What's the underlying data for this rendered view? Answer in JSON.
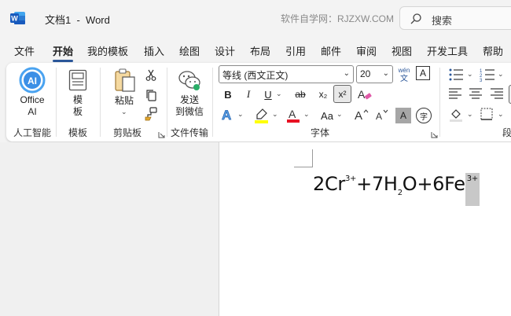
{
  "titlebar": {
    "doc_name": "文档1",
    "separator": "-",
    "app_name": "Word",
    "watermark": "软件自学网：RJZXW.COM",
    "search_placeholder": "搜索"
  },
  "tabs": [
    {
      "label": "文件"
    },
    {
      "label": "开始",
      "active": true
    },
    {
      "label": "我的模板"
    },
    {
      "label": "插入"
    },
    {
      "label": "绘图"
    },
    {
      "label": "设计"
    },
    {
      "label": "布局"
    },
    {
      "label": "引用"
    },
    {
      "label": "邮件"
    },
    {
      "label": "审阅"
    },
    {
      "label": "视图"
    },
    {
      "label": "开发工具"
    },
    {
      "label": "帮助"
    }
  ],
  "ribbon": {
    "office_ai": {
      "line1": "Office",
      "line2": "AI",
      "group": "人工智能"
    },
    "template": {
      "line1": "模",
      "line2": "板",
      "group": "模板"
    },
    "clipboard": {
      "paste": "粘贴",
      "group": "剪贴板"
    },
    "file_transfer": {
      "line1": "发送",
      "line2": "到微信",
      "group": "文件传输"
    },
    "font": {
      "font_name": "等线 (西文正文)",
      "font_size": "20",
      "wen_label": "wén",
      "wen_char": "文",
      "a_box": "A",
      "bold": "B",
      "italic": "I",
      "underline": "U",
      "strike": "ab",
      "subscript": "x₂",
      "superscript": "x²",
      "aa": "Aa",
      "grow": "A^",
      "shrink": "A˅",
      "shade_a": "A",
      "circle_char": "字",
      "group": "字体"
    },
    "paragraph": {
      "group": "段"
    }
  },
  "document": {
    "equation": {
      "coef1": "2Cr",
      "sup1": "3+",
      "plus1": "+7H",
      "sub1": "2",
      "o": "O+6Fe",
      "sup2": "3+"
    }
  },
  "colors": {
    "accent": "#2b579a",
    "highlight_yellow": "#ffff00",
    "font_red": "#e81123",
    "selection": "#c8c8c8"
  }
}
